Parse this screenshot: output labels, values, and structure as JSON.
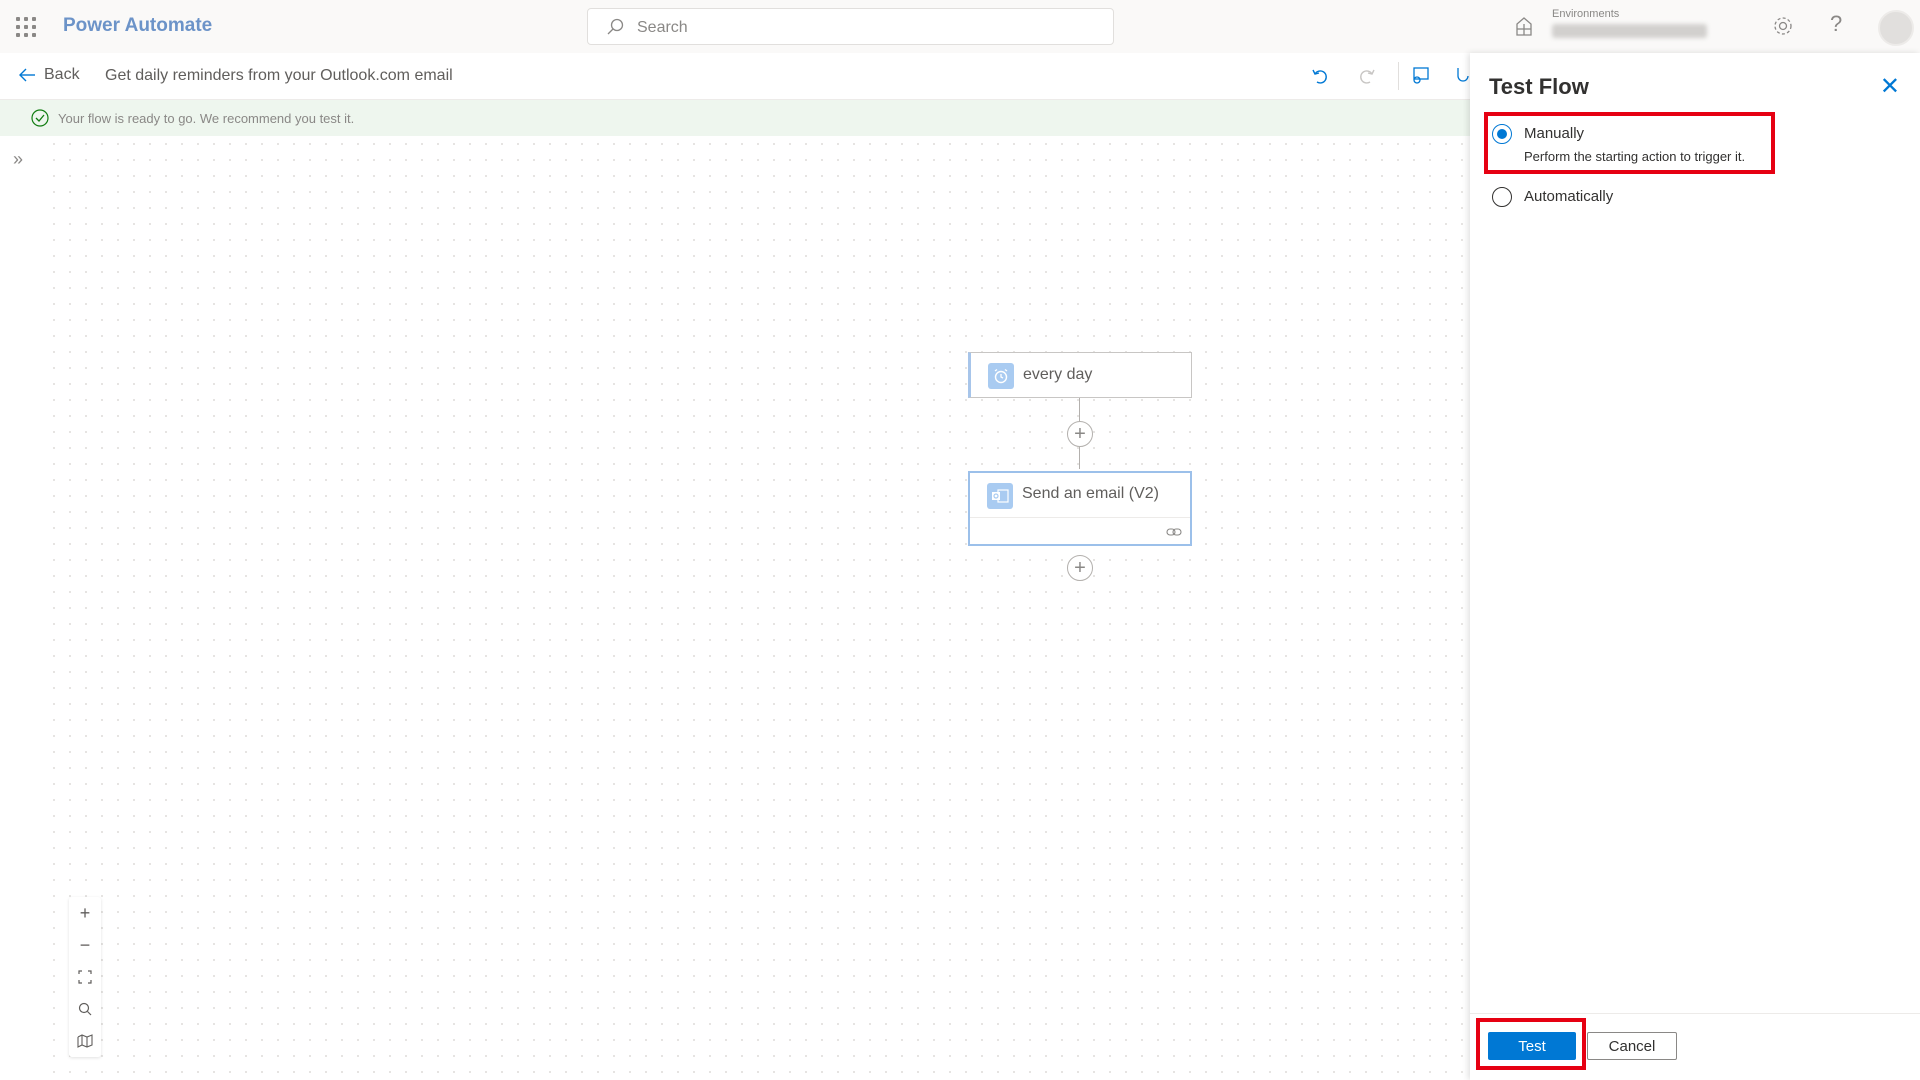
{
  "app": {
    "title": "Power Automate"
  },
  "search": {
    "placeholder": "Search"
  },
  "environment": {
    "label": "Environments"
  },
  "header": {
    "help_label": "?"
  },
  "command_bar": {
    "back_label": "Back",
    "flow_title": "Get daily reminders from your Outlook.com email"
  },
  "banner": {
    "message": "Your flow is ready to go. We recommend you test it."
  },
  "canvas": {
    "trigger": {
      "label": "every day",
      "icon": "alarm-clock-icon"
    },
    "action": {
      "label": "Send an email (V2)",
      "icon": "outlook-icon"
    }
  },
  "test_panel": {
    "title": "Test Flow",
    "options": [
      {
        "label": "Manually",
        "description": "Perform the starting action to trigger it.",
        "selected": true
      },
      {
        "label": "Automatically",
        "selected": false
      }
    ],
    "test_button": "Test",
    "cancel_button": "Cancel"
  },
  "colors": {
    "accent": "#0078d4",
    "highlight": "#e60012",
    "banner_bg": "#eef6ee"
  }
}
